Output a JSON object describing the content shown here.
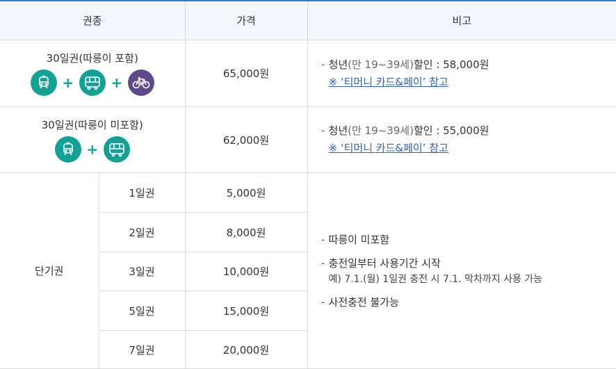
{
  "headers": {
    "type": "권종",
    "price": "가격",
    "note": "비고"
  },
  "rows": [
    {
      "name": "30일권(따릉이 포함)",
      "icons": [
        "subway-icon",
        "bus-icon",
        "bicycle-icon"
      ],
      "price": "65,000원",
      "note": {
        "prefix": "청년",
        "range": "(만 19~39세)",
        "suffix": "할인 : 58,000원",
        "link": "※ ‘티머니 카드&페이’ 참고"
      }
    },
    {
      "name": "30일권(따릉이 미포함)",
      "icons": [
        "subway-icon",
        "bus-icon"
      ],
      "price": "62,000원",
      "note": {
        "prefix": "청년",
        "range": "(만 19~39세)",
        "suffix": "할인 : 55,000원",
        "link": "※ ‘티머니 카드&페이’ 참고"
      }
    }
  ],
  "short_term": {
    "label": "단기권",
    "items": [
      {
        "name": "1일권",
        "price": "5,000원"
      },
      {
        "name": "2일권",
        "price": "8,000원"
      },
      {
        "name": "3일권",
        "price": "10,000원"
      },
      {
        "name": "5일권",
        "price": "15,000원"
      },
      {
        "name": "7일권",
        "price": "20,000원"
      }
    ],
    "notes": {
      "bike": "따릉이 미포함",
      "start": "충전일부터 사용기간 시작",
      "example_prefix": "예) 7.1.",
      "example_day": "(월)",
      "example_rest": " 1일권 충전 시 7.1. 막차까지 사용 가능",
      "no_precharge": "사전충전 불가능"
    }
  },
  "colors": {
    "accent": "#1e7fd8",
    "teal": "#13a195",
    "purple": "#5e4a8a",
    "link": "#2b63c6"
  }
}
